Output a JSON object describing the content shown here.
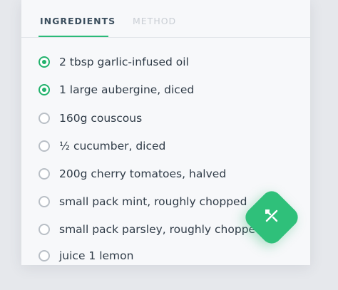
{
  "tabs": {
    "ingredients": "INGREDIENTS",
    "method": "METHOD"
  },
  "ingredients": [
    {
      "label": "2 tbsp garlic-infused oil",
      "checked": true
    },
    {
      "label": "1 large aubergine, diced",
      "checked": true
    },
    {
      "label": "160g couscous",
      "checked": false
    },
    {
      "label": "½ cucumber, diced",
      "checked": false
    },
    {
      "label": "200g cherry tomatoes, halved",
      "checked": false
    },
    {
      "label": "small pack mint, roughly chopped",
      "checked": false
    },
    {
      "label": "small pack parsley, roughly chopped",
      "checked": false
    },
    {
      "label": "juice 1 lemon",
      "checked": false
    }
  ],
  "fab": {
    "icon": "utensils-crossed-icon"
  },
  "colors": {
    "accent": "#2aba78",
    "text": "#2f3b47",
    "inactive_tab": "#c9ced4"
  }
}
